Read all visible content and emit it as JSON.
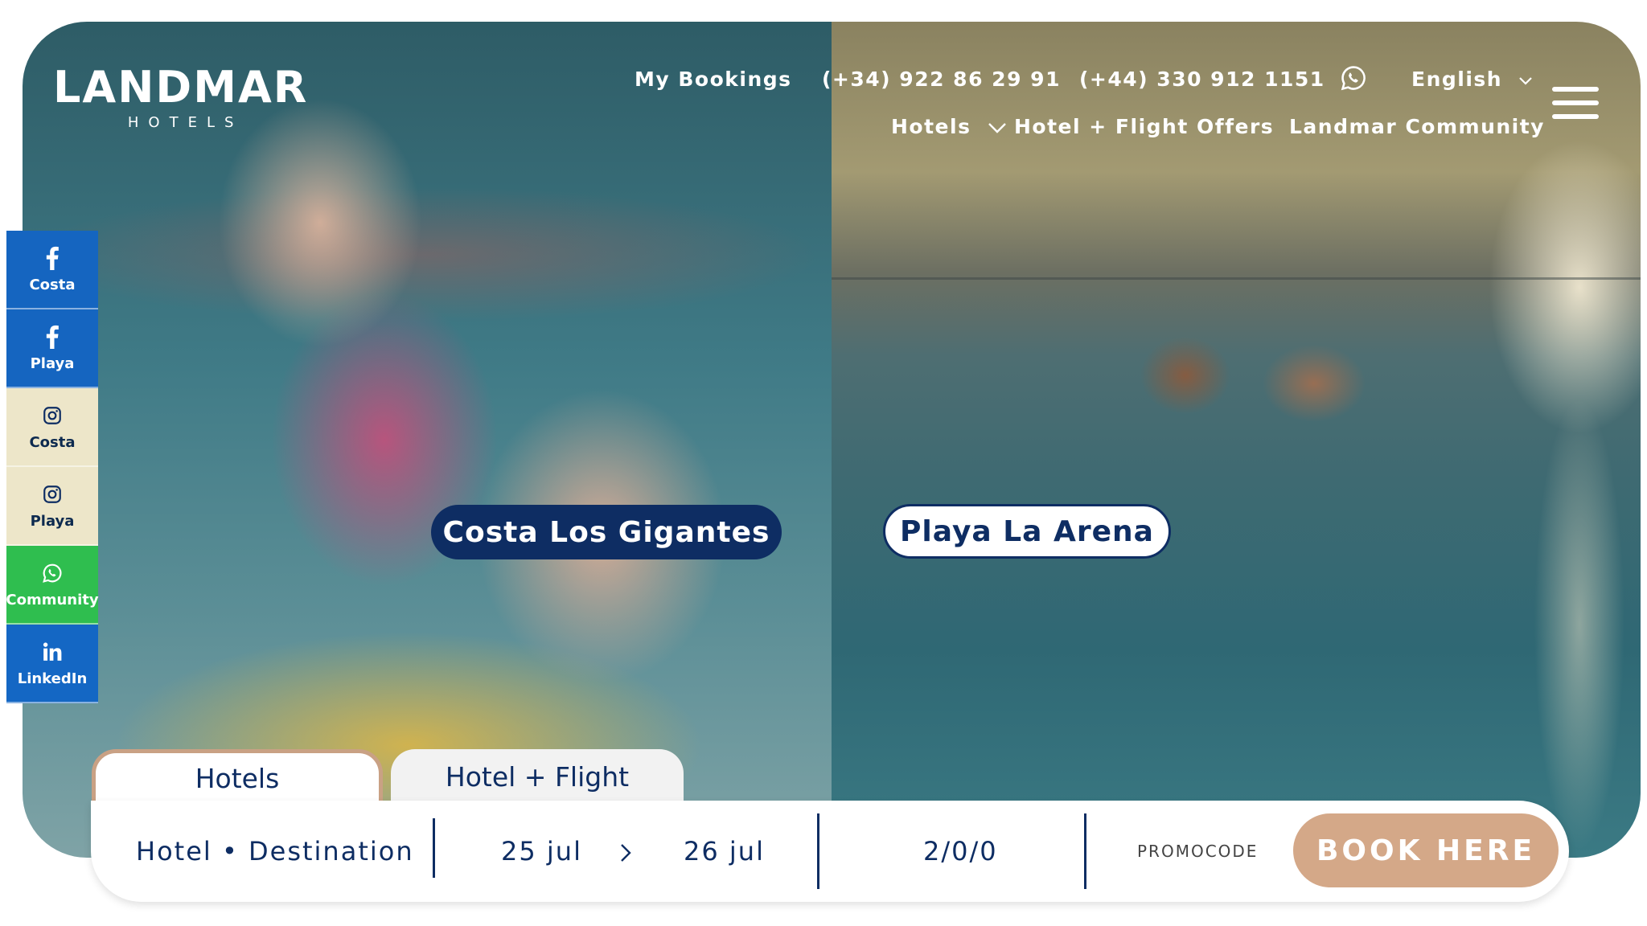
{
  "brand": {
    "name": "LANDMAR",
    "sub": "HOTELS"
  },
  "topbar": {
    "my_bookings": "My Bookings",
    "phone_es": "(+34) 922 86 29 91",
    "phone_uk": "(+44) 330 912 1151",
    "language": "English"
  },
  "mainnav": {
    "hotels": "Hotels",
    "hotel_flight": "Hotel + Flight",
    "offers": "Offers",
    "community": "Landmar Community"
  },
  "social": [
    {
      "icon": "facebook-icon",
      "label": "Costa"
    },
    {
      "icon": "facebook-icon",
      "label": "Playa"
    },
    {
      "icon": "instagram-icon",
      "label": "Costa"
    },
    {
      "icon": "instagram-icon",
      "label": "Playa"
    },
    {
      "icon": "whatsapp-icon",
      "label": "Community"
    },
    {
      "icon": "linkedin-icon",
      "label": "LinkedIn"
    }
  ],
  "destinations": {
    "left": "Costa Los Gigantes",
    "right": "Playa La Arena"
  },
  "tabs": {
    "hotels": "Hotels",
    "hotel_flight": "Hotel + Flight"
  },
  "booking": {
    "destination": "Hotel • Destination",
    "checkin": "25 jul",
    "checkout": "26 jul",
    "guests": "2/0/0",
    "promocode": "PROMOCODE",
    "book_label": "BOOK HERE"
  },
  "colors": {
    "navy": "#0e2d63",
    "accent": "#d4a888",
    "facebook": "#1565c0",
    "instagram_bg": "#ede6c9",
    "whatsapp": "#2fbe4f",
    "linkedin": "#1467c4"
  }
}
